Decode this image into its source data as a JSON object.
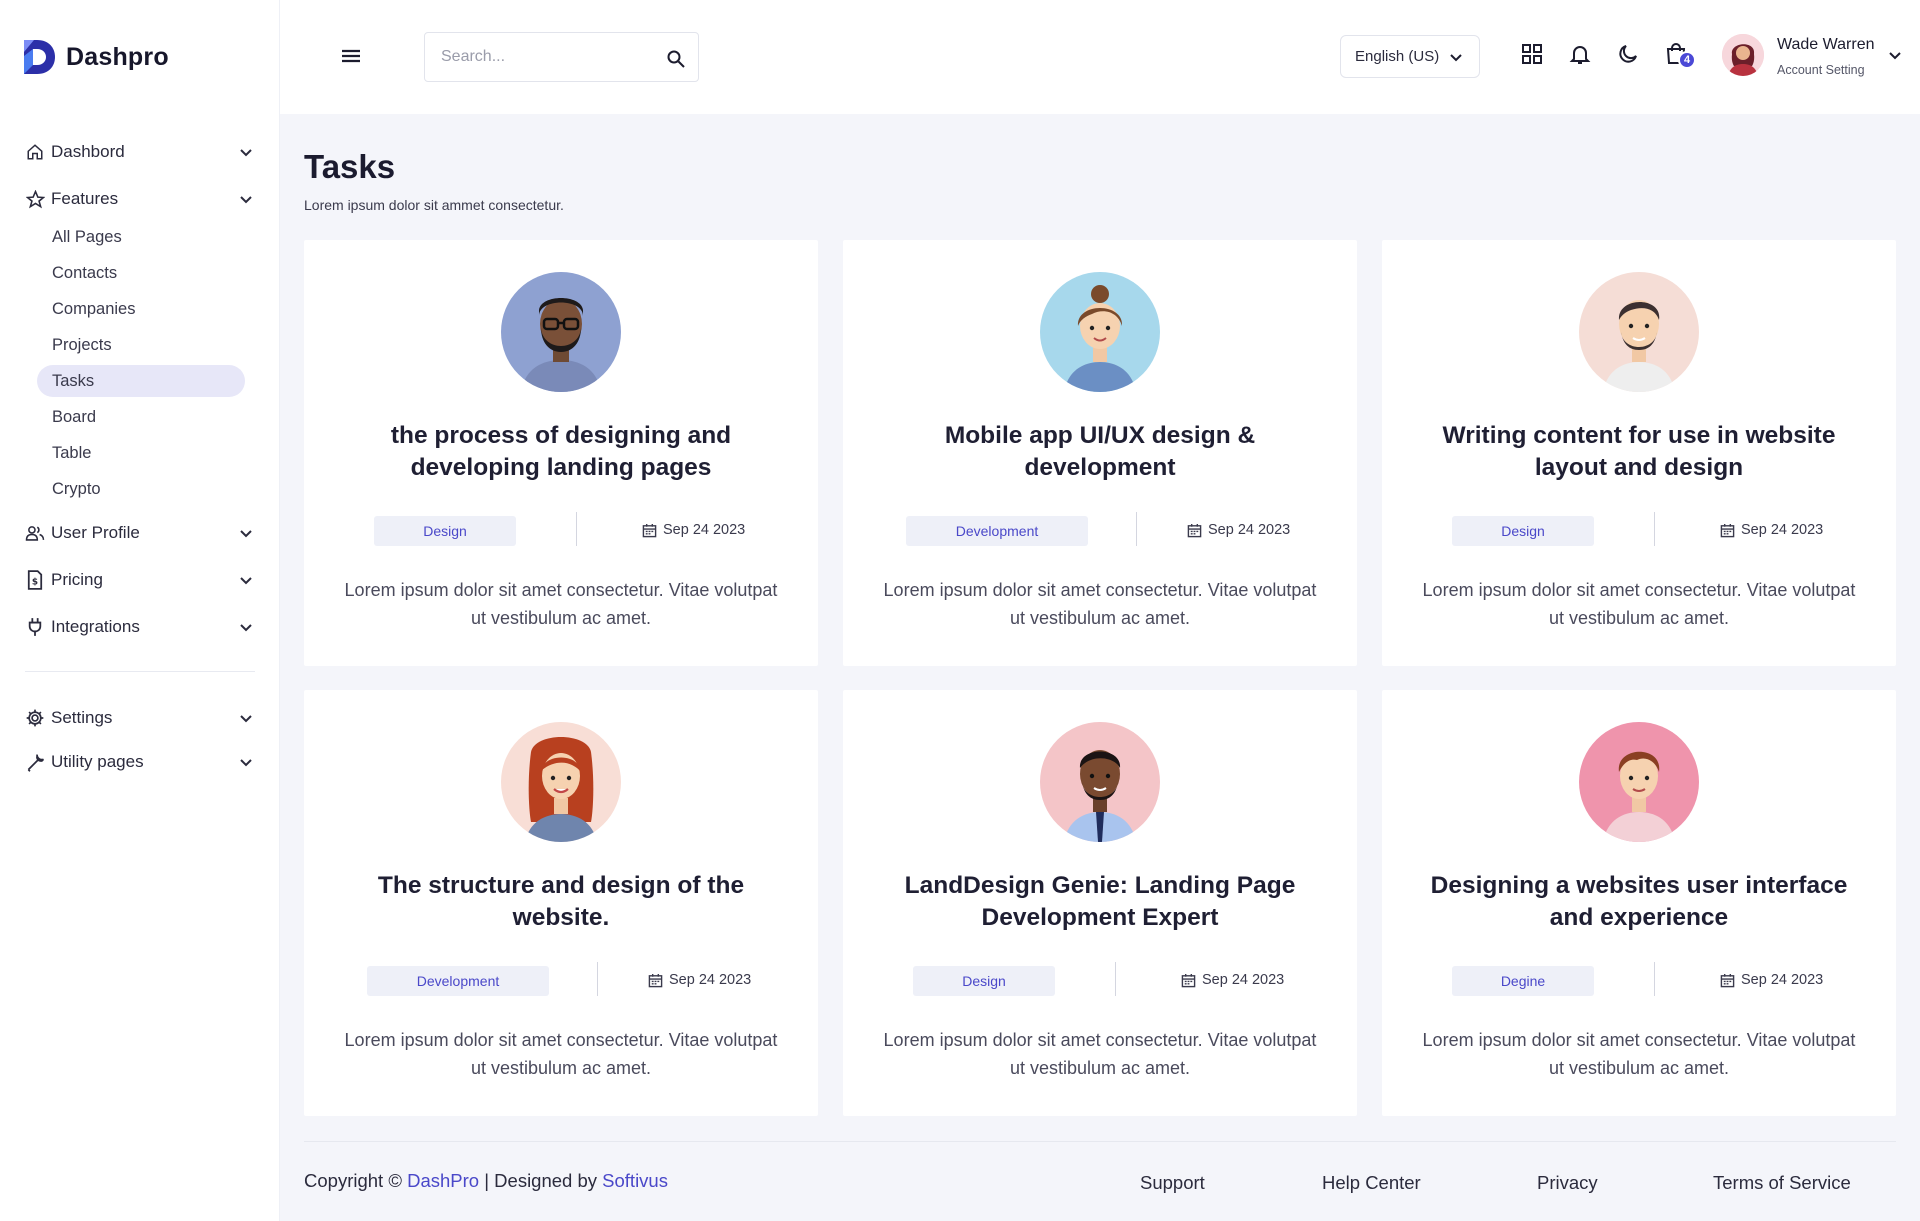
{
  "brand": {
    "name": "Dashpro"
  },
  "sidebar": {
    "groups": [
      {
        "label": "Dashbord",
        "icon": "home-icon"
      },
      {
        "label": "Features",
        "icon": "star-icon"
      },
      {
        "label": "User Profile",
        "icon": "users-icon"
      },
      {
        "label": "Pricing",
        "icon": "invoice-icon"
      },
      {
        "label": "Integrations",
        "icon": "plug-icon"
      },
      {
        "label": "Settings",
        "icon": "gear-icon"
      },
      {
        "label": "Utility pages",
        "icon": "wrench-icon"
      }
    ],
    "features_items": [
      "All Pages",
      "Contacts",
      "Companies",
      "Projects",
      "Tasks",
      "Board",
      "Table",
      "Crypto"
    ],
    "active_item": "Tasks"
  },
  "header": {
    "search_placeholder": "Search...",
    "language": "English (US)",
    "cart_count": "4",
    "user": {
      "name": "Wade Warren",
      "subtitle": "Account Setting"
    }
  },
  "page": {
    "title": "Tasks",
    "subtitle": "Lorem ipsum dolor sit ammet consectetur."
  },
  "cards": [
    {
      "title": "the process of designing and developing landing pages",
      "tag": "Design",
      "date": "Sep 24 2023",
      "desc": "Lorem ipsum dolor sit amet consectetur. Vitae volutpat ut vestibulum ac amet."
    },
    {
      "title": "Mobile app UI/UX design & development",
      "tag": "Development",
      "date": "Sep 24 2023",
      "desc": "Lorem ipsum dolor sit amet consectetur. Vitae volutpat ut vestibulum ac amet."
    },
    {
      "title": "Writing content for use in website layout and design",
      "tag": "Design",
      "date": "Sep 24 2023",
      "desc": "Lorem ipsum dolor sit amet consectetur. Vitae volutpat ut vestibulum ac amet."
    },
    {
      "title": "The structure and design of the website.",
      "tag": "Development",
      "date": "Sep 24 2023",
      "desc": "Lorem ipsum dolor sit amet consectetur. Vitae volutpat ut vestibulum ac amet."
    },
    {
      "title": "LandDesign Genie: Landing Page Development Expert",
      "tag": "Design",
      "date": "Sep 24 2023",
      "desc": "Lorem ipsum dolor sit amet consectetur. Vitae volutpat ut vestibulum ac amet."
    },
    {
      "title": "Designing a websites user interface and experience",
      "tag": "Degine",
      "date": "Sep 24 2023",
      "desc": "Lorem ipsum dolor sit amet consectetur. Vitae volutpat ut vestibulum ac amet."
    }
  ],
  "footer": {
    "copyright_prefix": "Copyright ©",
    "brand_link": "DashPro",
    "designed_by": "| Designed by",
    "designer_link": "Softivus",
    "links": [
      "Support",
      "Help Center",
      "Privacy",
      "Terms of Service"
    ]
  },
  "colors": {
    "accent": "#4a48c9",
    "background": "#f4f5fa",
    "active_bg": "#e7e7f8"
  }
}
